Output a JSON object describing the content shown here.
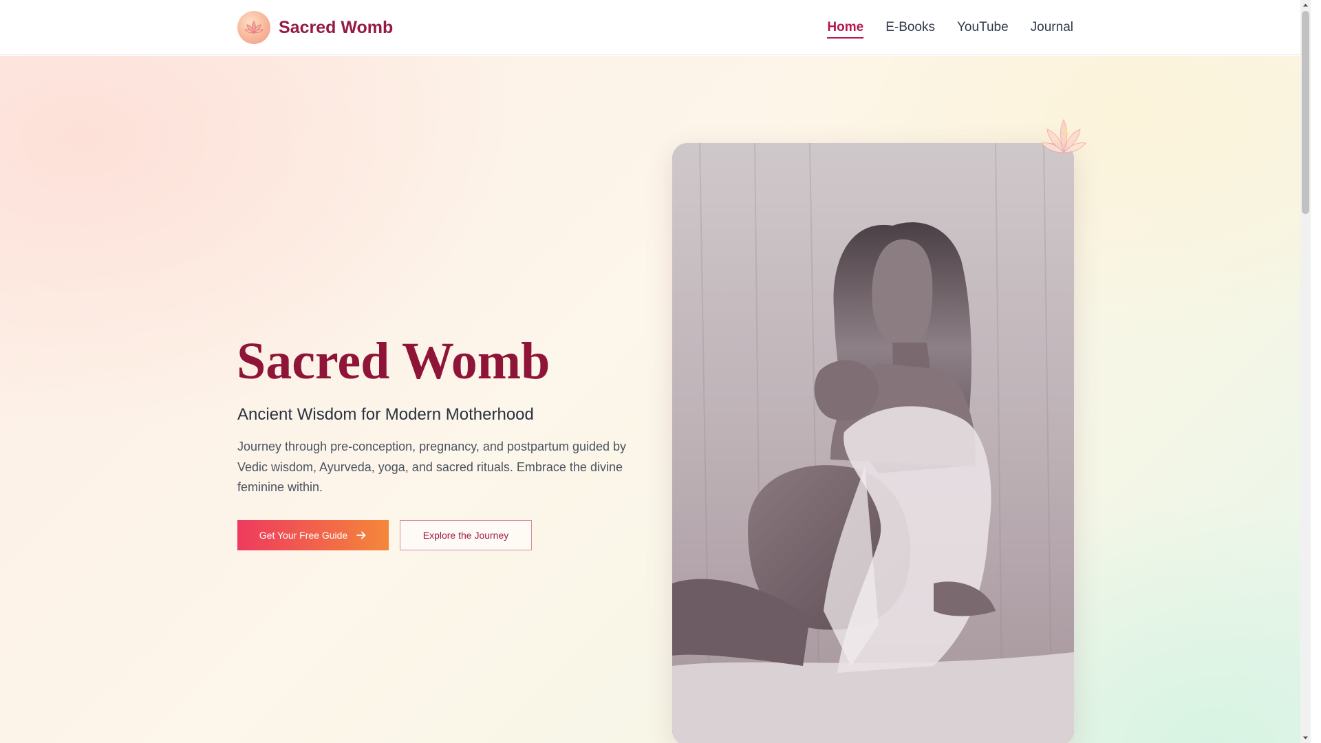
{
  "header": {
    "brand_name": "Sacred Womb",
    "logo_icon": "lotus-icon",
    "nav": [
      {
        "label": "Home",
        "active": true
      },
      {
        "label": "E-Books",
        "active": false
      },
      {
        "label": "YouTube",
        "active": false
      },
      {
        "label": "Journal",
        "active": false
      }
    ]
  },
  "hero": {
    "title": "Sacred Womb",
    "subtitle": "Ancient Wisdom for Modern Motherhood",
    "description": "Journey through pre-conception, pregnancy, and postpartum guided by Vedic wisdom, Ayurveda, yoga, and sacred rituals. Embrace the divine feminine within.",
    "primary_button": "Get Your Free Guide",
    "secondary_button": "Explore the Journey",
    "photo_alt": "Black and white photo of a pregnant woman in a sheer white robe",
    "decoration_icon": "lotus-icon"
  },
  "colors": {
    "brand": "#951a46",
    "accent_start": "#ee3a5e",
    "accent_end": "#f4873a"
  }
}
